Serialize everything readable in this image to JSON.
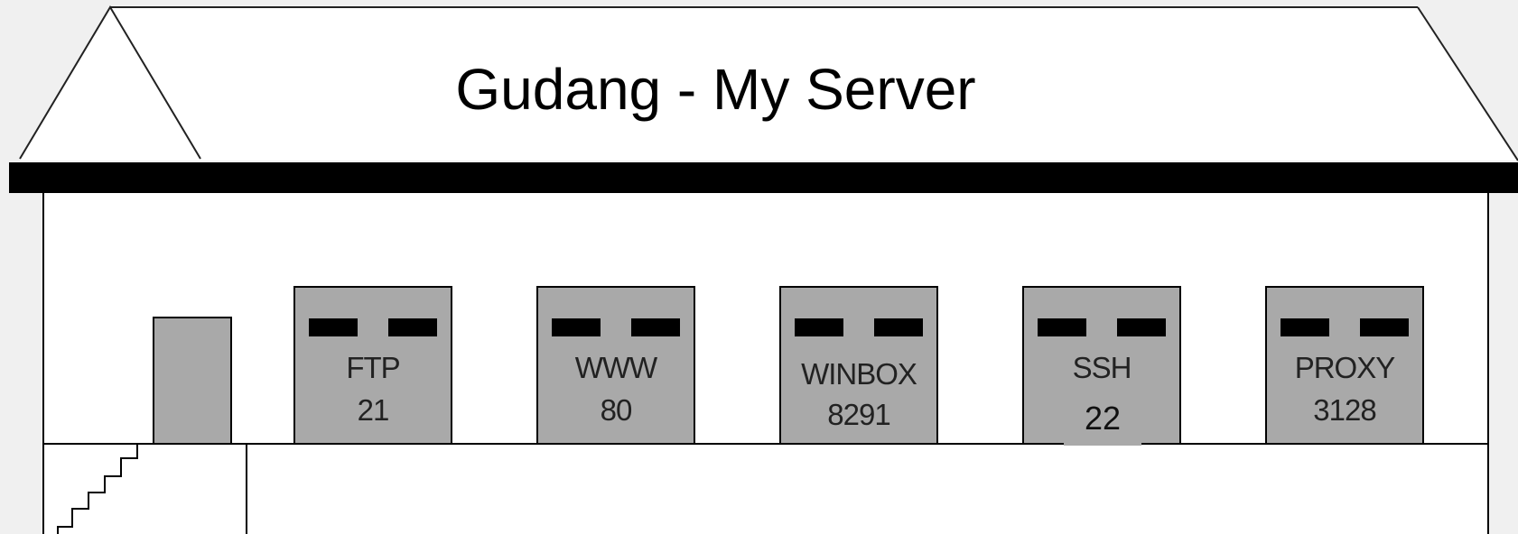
{
  "title": "Gudang - My Server",
  "colors": {
    "background": "#f0f0f0",
    "building": "#ffffff",
    "outline": "#000000",
    "door_fill": "#a9a9a9",
    "text": "#222222"
  },
  "doors": [
    {
      "service": "FTP",
      "port": "21"
    },
    {
      "service": "WWW",
      "port": "80"
    },
    {
      "service": "WINBOX",
      "port": "8291"
    },
    {
      "service": "SSH",
      "port": "22"
    },
    {
      "service": "PROXY",
      "port": "3128"
    }
  ]
}
